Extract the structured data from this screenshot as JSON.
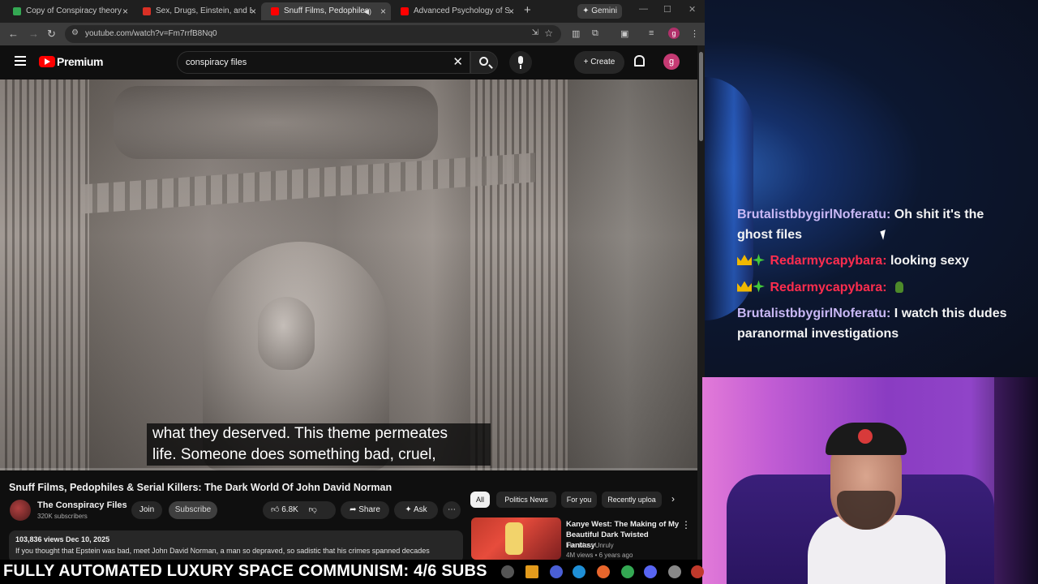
{
  "browser": {
    "tabs": [
      {
        "label": "Copy of Conspiracy theory / tr",
        "favicon_color": "#34a853",
        "active": false
      },
      {
        "label": "Sex, Drugs, Einstein, and Elves",
        "favicon_color": "#d93025",
        "active": false
      },
      {
        "label": "Snuff Films, Pedophiles & S",
        "favicon_color": "#ff0000",
        "active": true
      },
      {
        "label": "Advanced Psychology of Serial",
        "favicon_color": "#ff0000",
        "active": false
      }
    ],
    "new_tab_glyph": "+",
    "gemini_label": "Gemini",
    "url": "youtube.com/watch?v=Fm7rrfB8Nq0",
    "profile_initial": "g"
  },
  "youtube": {
    "logo_text": "Premium",
    "search_query": "conspiracy files",
    "create_label": "Create",
    "avatar_initial": "g",
    "subtitle_line1": "what they deserved. This theme permeates",
    "subtitle_line2": "life. Someone does something bad, cruel,",
    "progress_fraction": 0.0,
    "video_title": "Snuff Films, Pedophiles & Serial Killers: The Dark World Of John David Norman",
    "channel_name": "The Conspiracy Files",
    "channel_subs": "320K subscribers",
    "join_label": "Join",
    "subscribe_label": "Subscribe",
    "like_count": "6.8K",
    "share_label": "Share",
    "ask_label": "Ask",
    "views_date": "103,836 views  Dec 10, 2025",
    "description": "If you thought that Epstein was bad, meet John David Norman, a man so depraved, so sadistic that his crimes spanned decades",
    "chips": [
      "All",
      "Politics News",
      "For you",
      "Recently uploa"
    ],
    "recommended": {
      "title": "Kanye West: The Making of My Beautiful Dark Twisted Fantasy",
      "channel": "The Most Unruly",
      "meta": "4M views • 6 years ago"
    }
  },
  "chat": {
    "messages": [
      {
        "user": "BrutalistbbygirlNoferatu:",
        "text": "Oh shit it's the ghost files",
        "badges": false
      },
      {
        "user": "Redarmycapybara:",
        "text": "looking sexy",
        "badges": true
      },
      {
        "user": "Redarmycapybara:",
        "text": "",
        "badges": true
      },
      {
        "user": "BrutalistbbygirlNoferatu:",
        "text": "I watch this dudes paranormal investigations",
        "badges": false
      }
    ]
  },
  "ticker": {
    "text": "FULLY AUTOMATED LUXURY SPACE COMMUNISM: 4/6 SUBS"
  },
  "colors": {
    "chat_user_primary": "#c9b8f5",
    "chat_user_secondary": "#ff2d4e",
    "youtube_red": "#ff0000"
  }
}
